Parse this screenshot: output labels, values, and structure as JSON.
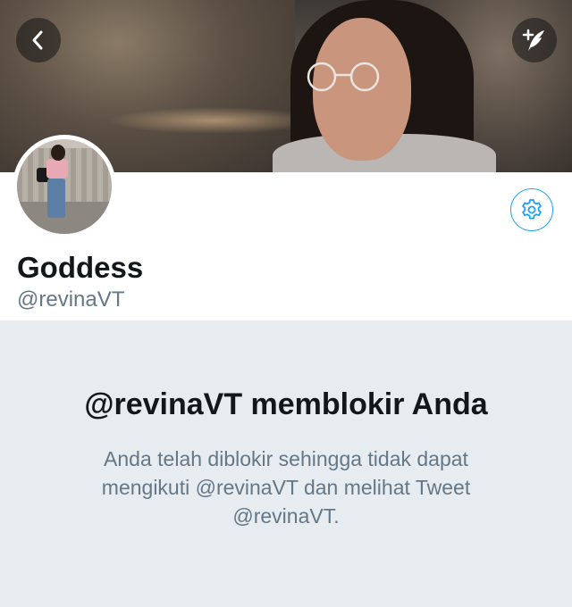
{
  "colors": {
    "accent": "#1da1f2",
    "name_text": "#14171a",
    "secondary_text": "#657786",
    "panel_bg": "#e6ecf0"
  },
  "nav": {
    "back_icon": "chevron-left-icon",
    "compose_icon": "compose-feather-icon"
  },
  "profile": {
    "display_name": "Goddess",
    "handle": "@revinaVT",
    "settings_icon": "gear-icon"
  },
  "blocked": {
    "title": "@revinaVT memblokir Anda",
    "description": "Anda telah diblokir sehingga tidak dapat mengikuti @revinaVT dan melihat Tweet @revinaVT."
  }
}
